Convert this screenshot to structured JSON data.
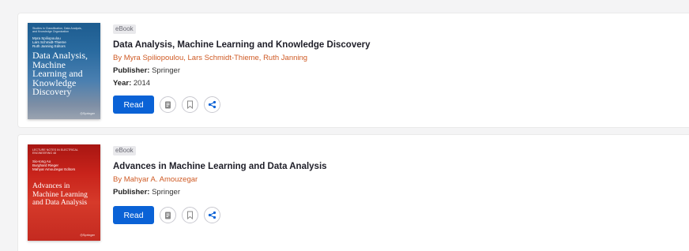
{
  "results": [
    {
      "badge": "eBook",
      "title": "Data Analysis, Machine Learning and Knowledge Discovery",
      "authors": "By Myra Spiliopoulou, Lars Schmidt-Thieme, Ruth Janning",
      "publisher_label": "Publisher:",
      "publisher": "Springer",
      "year_label": "Year:",
      "year": "2014",
      "read_label": "Read",
      "cover": {
        "series": "Studies in Classification, Data Analysis,\nand Knowledge Organization",
        "authors": "Myra Spiliopoulou\nLars Schmidt-Thieme\nRuth Janning  Editors",
        "title": "Data Analysis,\nMachine\nLearning and\nKnowledge\nDiscovery",
        "publisher": "Springer",
        "color": "#2a6ba0"
      }
    },
    {
      "badge": "eBook",
      "title": "Advances in Machine Learning and Data Analysis",
      "authors": "By Mahyar A. Amouzegar",
      "publisher_label": "Publisher:",
      "publisher": "Springer",
      "read_label": "Read",
      "cover": {
        "series": "LECTURE NOTES IN ELECTRICAL ENGINEERING   48",
        "authors": "Sio-Iong Ao\nBurghard Rieger\nMahyar Amouzegar  Editors",
        "title": "Advances in\nMachine Learning\nand Data Analysis",
        "publisher": "Springer",
        "color": "#c8231b"
      }
    }
  ],
  "icons": {
    "details": "document-icon",
    "bookmark": "bookmark-icon",
    "share": "share-icon"
  },
  "colors": {
    "accent": "#0a62d6",
    "author_link": "#cf5a24",
    "title": "#1e1e28"
  }
}
